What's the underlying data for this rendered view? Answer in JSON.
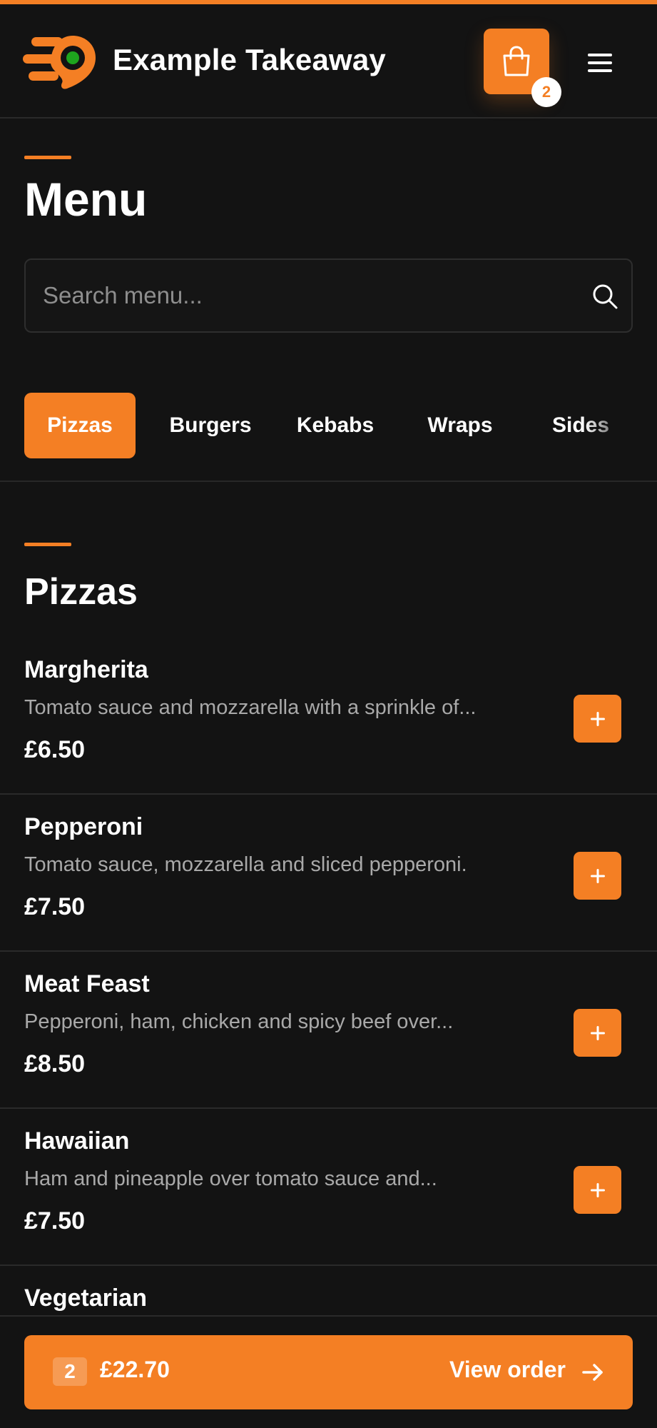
{
  "colors": {
    "accent": "#f47f24",
    "background": "#131313",
    "logo_dot": "#1ea51e"
  },
  "header": {
    "brand_name": "Example Takeaway",
    "logo_icon": "delivery-pin-logo",
    "cart_icon": "shopping-bag-icon",
    "cart_count": "2",
    "menu_icon": "hamburger-menu-icon"
  },
  "page": {
    "title": "Menu"
  },
  "search": {
    "placeholder": "Search menu...",
    "value": "",
    "icon": "search-icon"
  },
  "categories": [
    {
      "label": "Pizzas",
      "active": true
    },
    {
      "label": "Burgers",
      "active": false
    },
    {
      "label": "Kebabs",
      "active": false
    },
    {
      "label": "Wraps",
      "active": false
    },
    {
      "label": "Sides",
      "active": false
    }
  ],
  "section": {
    "title": "Pizzas",
    "items": [
      {
        "name": "Margherita",
        "description": "Tomato sauce and mozzarella with a sprinkle of...",
        "price": "£6.50",
        "add_label": "+"
      },
      {
        "name": "Pepperoni",
        "description": "Tomato sauce, mozzarella and sliced pepperoni.",
        "price": "£7.50",
        "add_label": "+"
      },
      {
        "name": "Meat Feast",
        "description": "Pepperoni, ham, chicken and spicy beef over...",
        "price": "£8.50",
        "add_label": "+"
      },
      {
        "name": "Hawaiian",
        "description": "Ham and pineapple over tomato sauce and...",
        "price": "£7.50",
        "add_label": "+"
      },
      {
        "name": "Vegetarian",
        "description": "",
        "price": "",
        "add_label": ""
      }
    ]
  },
  "order_bar": {
    "count": "2",
    "total": "£22.70",
    "label": "View order",
    "icon": "arrow-right-icon"
  }
}
